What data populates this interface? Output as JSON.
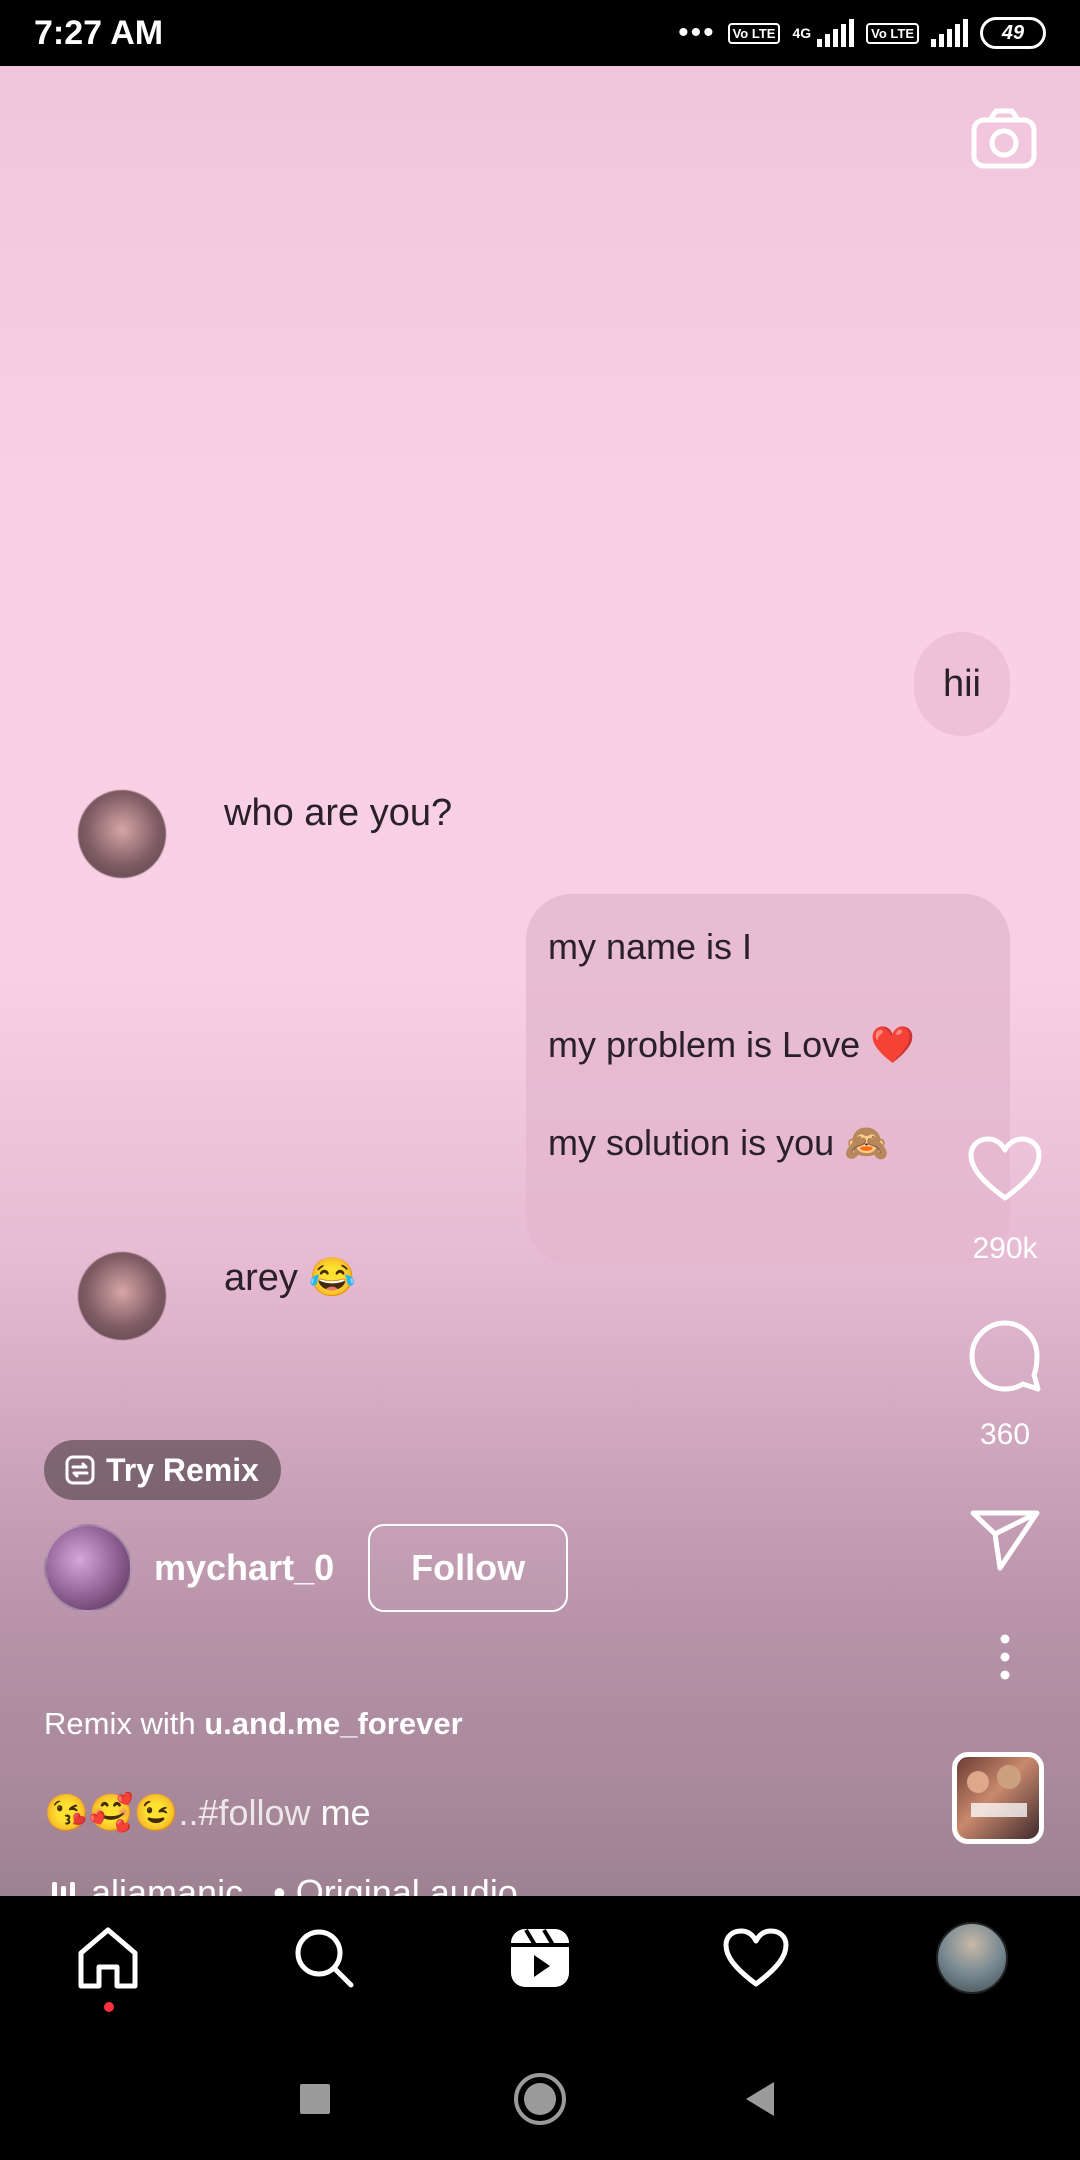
{
  "status_bar": {
    "time": "7:27 AM",
    "network_1": "Vo LTE",
    "network_type": "4G",
    "network_2": "Vo LTE",
    "battery": "49"
  },
  "video": {
    "messages": {
      "hii": "hii",
      "who": "who are you?",
      "name_line": "my name is I",
      "problem_line": "my problem is Love ❤️",
      "solution_line": "my solution is you 🙈",
      "arey": "arey 😂"
    }
  },
  "actions": {
    "likes": "290k",
    "comments": "360"
  },
  "info": {
    "try_remix": "Try Remix",
    "author": "mychart_0",
    "follow": "Follow",
    "remix_prefix": "Remix with",
    "remix_user": "u.and.me_forever",
    "caption_emojis": "😘🥰😉",
    "caption_tag": "..#follow",
    "caption_rest": " me",
    "audio": "aliamanic_ • Original audio"
  },
  "album_art": {
    "text": "ALIA BHATT"
  },
  "icons": {
    "camera": "camera-icon",
    "like": "heart-icon",
    "comment": "comment-icon",
    "share": "send-icon",
    "more": "more-icon",
    "remix": "remix-icon",
    "home": "home-icon",
    "search": "search-icon",
    "reels": "reels-icon",
    "activity": "heart-icon",
    "profile": "avatar"
  },
  "colors": {
    "accent_dot": "#ff3040",
    "video_bg": "#fbd0e5"
  }
}
